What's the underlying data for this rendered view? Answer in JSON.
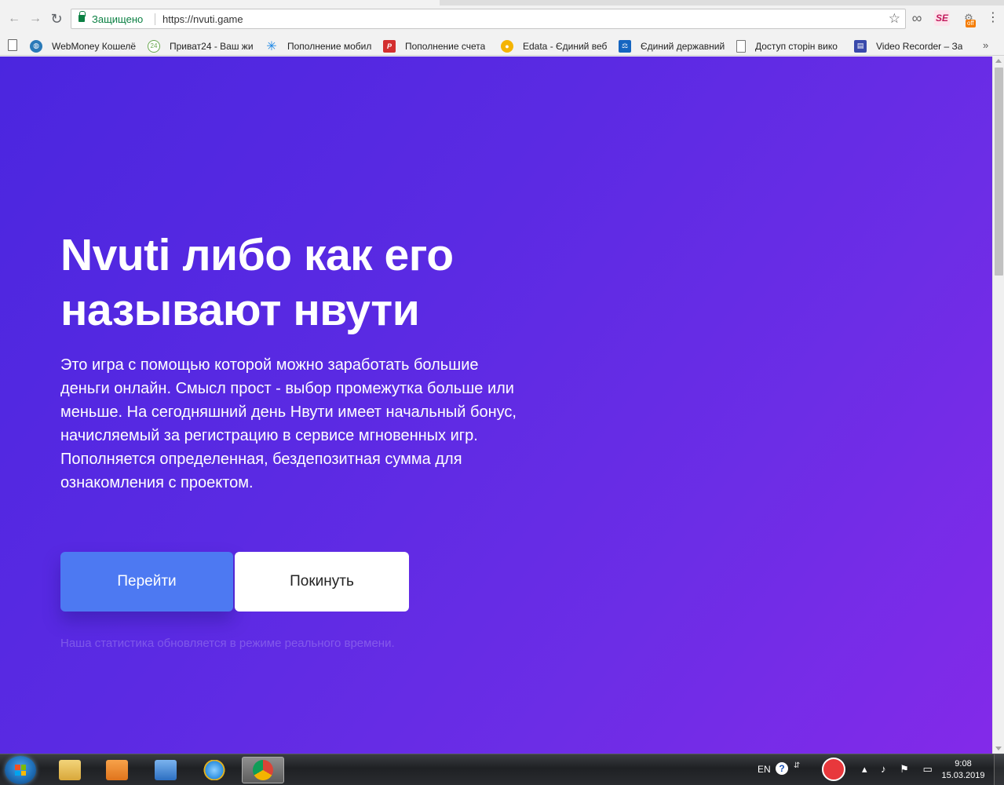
{
  "browser": {
    "security_label": "Защищено",
    "url": "https://nvuti.game",
    "ext_se_label": "SE",
    "ext_off_badge": "off",
    "bookmarks": [
      {
        "label": "WebMoney Кошелё",
        "icon": "globe-icon",
        "color": "#2a7ab8"
      },
      {
        "label": "Приват24 - Ваш жи",
        "icon": "privat24-icon",
        "color": "#6aa84f"
      },
      {
        "label": "Пополнение мобил",
        "icon": "kyivstar-star-icon",
        "color": "#1e88e5"
      },
      {
        "label": "Пополнение счета",
        "icon": "p-logo-icon",
        "color": "#d32f2f"
      },
      {
        "label": "Edata - Єдиний веб",
        "icon": "edata-icon",
        "color": "#f4b400"
      },
      {
        "label": "Єдиний державний",
        "icon": "registry-icon",
        "color": "#1565c0"
      },
      {
        "label": "Доступ сторін вико",
        "icon": "page-icon",
        "color": "#ffffff"
      },
      {
        "label": "Video Recorder – За",
        "icon": "clapper-icon",
        "color": "#3949ab"
      }
    ]
  },
  "hero": {
    "title": "Nvuti либо как его называют нвути",
    "description": "Это игра с помощью которой можно заработать большие деньги онлайн. Смысл прост - выбор промежутка больше или меньше. На сегодняшний день Нвути имеет начальный бонус, начисляемый за регистрацию в сервисе мгновенных игр. Пополняется определенная, бездепозитная сумма для ознакомления с проектом.",
    "go_button": "Перейти",
    "leave_button": "Покинуть",
    "stats_note": "Наша статистика обновляется в режиме реального времени."
  },
  "taskbar": {
    "apps": [
      {
        "name": "explorer",
        "icon": "folder-icon",
        "color": "#e8c25a"
      },
      {
        "name": "media-player",
        "icon": "media-player-icon",
        "color": "#f28a2a"
      },
      {
        "name": "volume-app",
        "icon": "speaker-icon",
        "color": "#4d8fd6"
      },
      {
        "name": "internet-explorer",
        "icon": "ie-icon",
        "color": "#2b8ee0"
      },
      {
        "name": "chrome",
        "icon": "chrome-icon",
        "color": "#db4437"
      }
    ],
    "language": "EN",
    "help_glyph": "?",
    "time": "9:08",
    "date": "15.03.2019"
  },
  "colors": {
    "gradient_start": "#4b26df",
    "gradient_end": "#832ae9",
    "primary_button": "#4d79f2",
    "secure_green": "#0b8043"
  }
}
